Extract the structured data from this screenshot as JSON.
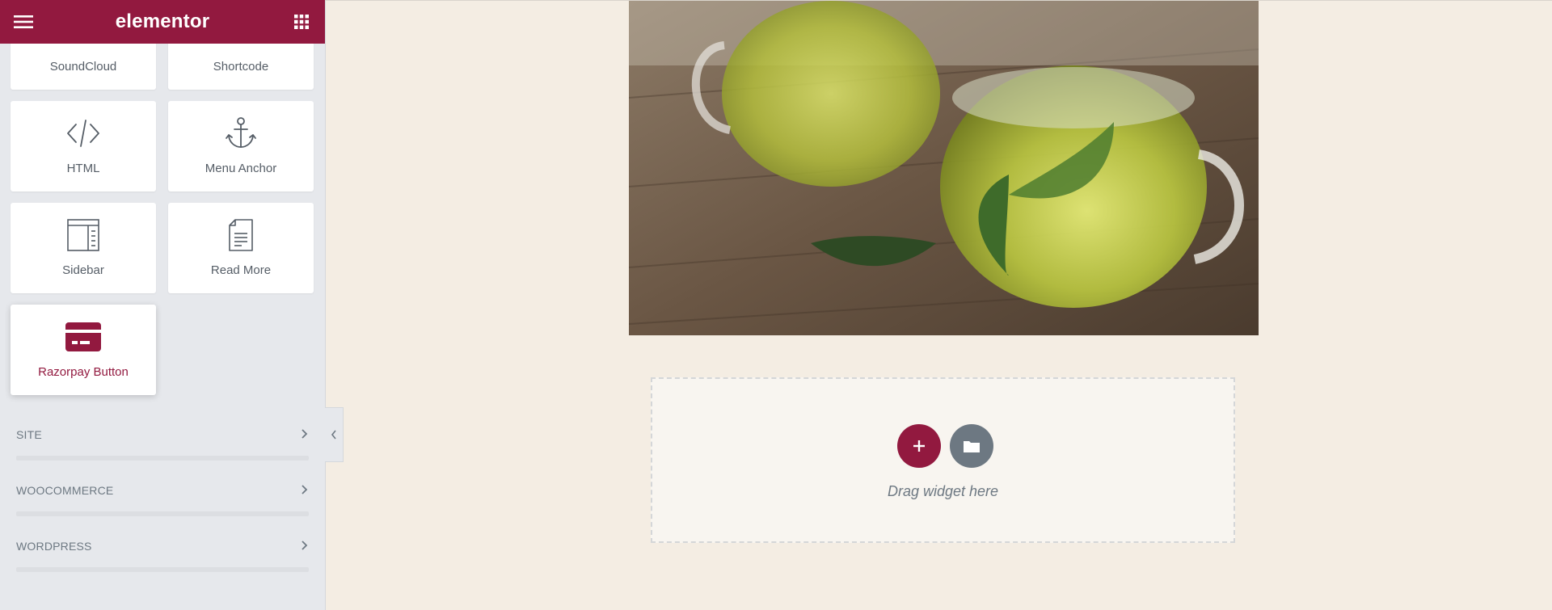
{
  "header": {
    "logo": "elementor",
    "menu_icon": "hamburger-menu-icon",
    "apps_icon": "grid-apps-icon"
  },
  "widgets": [
    {
      "label": "SoundCloud",
      "icon": "soundcloud-icon"
    },
    {
      "label": "Shortcode",
      "icon": "shortcode-icon"
    },
    {
      "label": "HTML",
      "icon": "code-icon"
    },
    {
      "label": "Menu Anchor",
      "icon": "anchor-icon"
    },
    {
      "label": "Sidebar",
      "icon": "sidebar-icon"
    },
    {
      "label": "Read More",
      "icon": "document-icon"
    },
    {
      "label": "Razorpay Button",
      "icon": "payment-card-icon"
    }
  ],
  "categories": [
    {
      "label": "SITE"
    },
    {
      "label": "WOOCOMMERCE"
    },
    {
      "label": "WORDPRESS"
    }
  ],
  "canvas": {
    "drop_text": "Drag widget here"
  },
  "colors": {
    "brand": "#92193f",
    "panel_bg": "#e6e8ec",
    "canvas_bg": "#f4ede3",
    "muted": "#6d7882"
  }
}
